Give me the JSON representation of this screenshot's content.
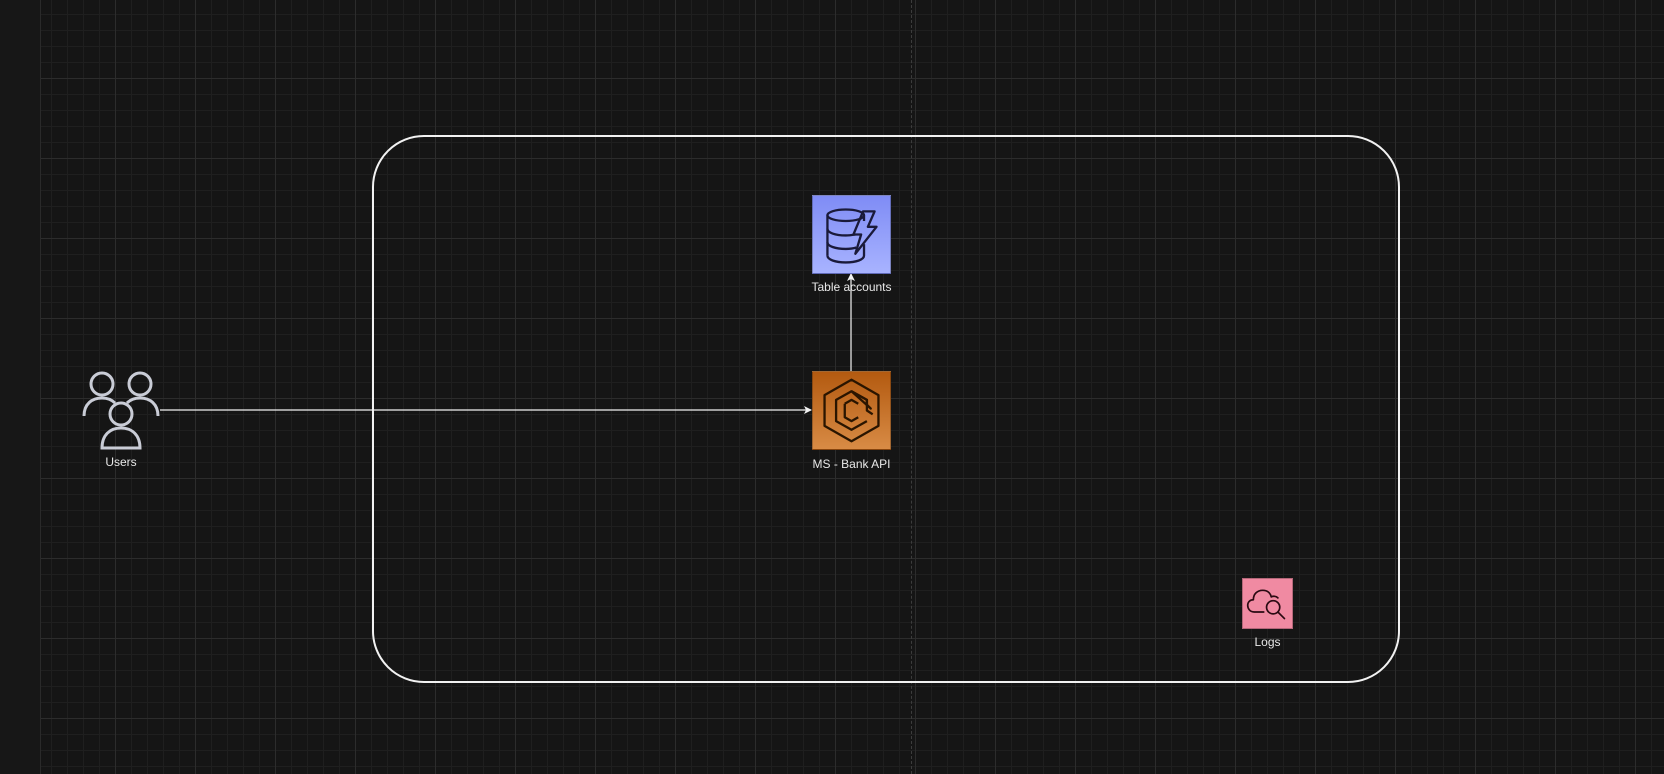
{
  "diagram": {
    "nodes": {
      "users": {
        "label": "Users",
        "icon": "users-icon"
      },
      "table_accounts": {
        "label": "Table accounts",
        "icon": "dynamodb-icon",
        "color": "#8f9bf9"
      },
      "ms_bank_api": {
        "label": "MS - Bank API",
        "icon": "ecs-container-icon",
        "color": "#c7711f"
      },
      "logs": {
        "label": "Logs",
        "icon": "cloudwatch-logs-icon",
        "color": "#f08aa2"
      }
    },
    "edges": [
      {
        "from": "Users",
        "to": "MS - Bank API"
      },
      {
        "from": "MS - Bank API",
        "to": "Table accounts"
      }
    ],
    "colors": {
      "background": "#151515",
      "edge": "#f2f2f2",
      "container_border": "#f2f2f2",
      "label": "#e8e8e8"
    }
  }
}
